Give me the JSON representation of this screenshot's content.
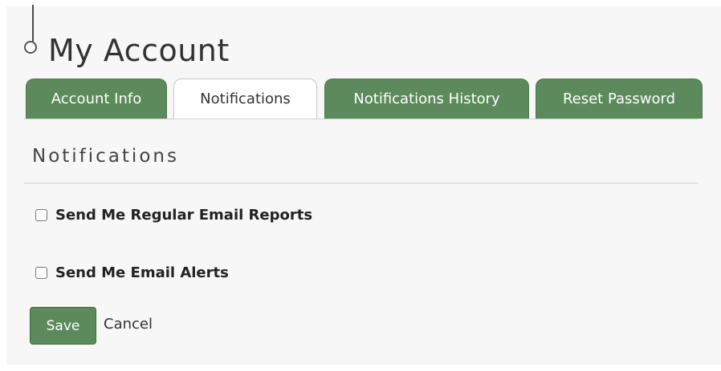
{
  "header": {
    "title": "My Account"
  },
  "tabs": [
    {
      "label": "Account Info",
      "active": false
    },
    {
      "label": "Notifications",
      "active": true
    },
    {
      "label": "Notifications History",
      "active": false
    },
    {
      "label": "Reset Password",
      "active": false
    }
  ],
  "section": {
    "title": "Notifications",
    "options": [
      {
        "label": "Send Me Regular Email Reports",
        "checked": false
      },
      {
        "label": "Send Me Email Alerts",
        "checked": false
      }
    ]
  },
  "actions": {
    "save_label": "Save",
    "cancel_label": "Cancel"
  },
  "colors": {
    "accent": "#5c8a5c",
    "panel_background": "#f7f7f7"
  }
}
